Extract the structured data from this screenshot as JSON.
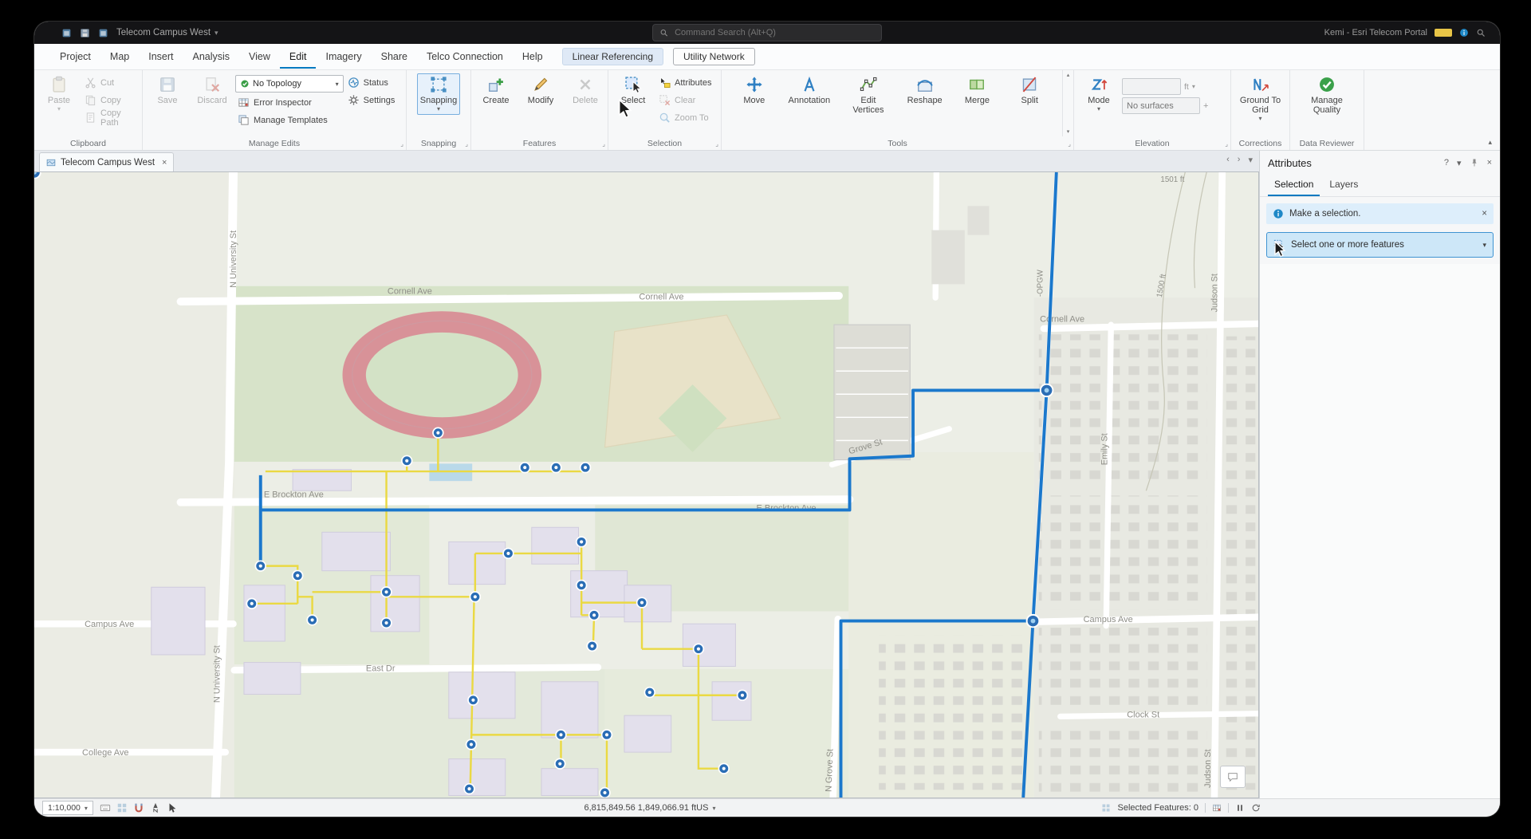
{
  "titlebar": {
    "title": "Telecom Campus West",
    "search_placeholder": "Command Search (Alt+Q)",
    "account": "Kemi - Esri Telecom Portal"
  },
  "menu": {
    "tabs": [
      "Project",
      "Map",
      "Insert",
      "Analysis",
      "View",
      "Edit",
      "Imagery",
      "Share",
      "Telco Connection",
      "Help"
    ],
    "contextual": [
      "Linear Referencing",
      "Utility Network"
    ]
  },
  "ribbon": {
    "clipboard": {
      "label": "Clipboard",
      "paste": "Paste",
      "cut": "Cut",
      "copy": "Copy",
      "copy_path": "Copy Path"
    },
    "manage_edits": {
      "label": "Manage Edits",
      "save": "Save",
      "discard": "Discard",
      "topology": "No Topology",
      "error_inspector": "Error Inspector",
      "manage_templates": "Manage Templates",
      "status": "Status",
      "settings": "Settings"
    },
    "snapping": {
      "label": "Snapping",
      "button": "Snapping"
    },
    "features": {
      "label": "Features",
      "create": "Create",
      "modify": "Modify",
      "delete": "Delete"
    },
    "selection": {
      "label": "Selection",
      "select": "Select",
      "attributes": "Attributes",
      "clear": "Clear",
      "zoom_to": "Zoom To"
    },
    "tools": {
      "label": "Tools",
      "move": "Move",
      "annotation": "Annotation",
      "edit_vertices": "Edit Vertices",
      "reshape": "Reshape",
      "merge": "Merge",
      "split": "Split"
    },
    "elevation": {
      "label": "Elevation",
      "mode": "Mode",
      "surfaces_placeholder": "No surfaces",
      "unit": "ft"
    },
    "corrections": {
      "label": "Corrections",
      "ground_to_grid": "Ground To Grid"
    },
    "data_reviewer": {
      "label": "Data Reviewer",
      "manage_quality": "Manage Quality"
    }
  },
  "map_tab": {
    "title": "Telecom Campus West"
  },
  "attributes_panel": {
    "title": "Attributes",
    "tab_selection": "Selection",
    "tab_layers": "Layers",
    "info_message": "Make a selection.",
    "dropdown_label": "Select one or more features"
  },
  "statusbar": {
    "scale": "1:10,000",
    "coordinates": "6,815,849.56 1,849,066.91 ftUS",
    "selected_features": "Selected Features: 0"
  },
  "map": {
    "labels": {
      "cornell_1": "Cornell Ave",
      "cornell_2": "Cornell Ave",
      "cornell_3": "Cornell Ave",
      "brockton_1": "E Brockton Ave",
      "brockton_2": "E Brockton Ave",
      "campus_left": "Campus Ave",
      "campus_right": "Campus Ave",
      "college": "College Ave",
      "east_dr": "East Dr",
      "grove": "Grove St",
      "clock": "Clock St",
      "n_university_1": "N University St",
      "n_university_2": "N University St",
      "emily": "Emily St",
      "judson_1": "Judson St",
      "judson_2": "Judson St",
      "n_grove": "N Grove St",
      "opgw": "-OPGW",
      "elev_top": "1501 ft",
      "elev_mid": "1500 ft"
    },
    "colors": {
      "utility_line": "#1b78cc",
      "fiber_line": "#ead943",
      "device": "#2a6db5"
    }
  },
  "glyphs": {
    "caret_down": "▾",
    "caret_up": "▴",
    "chevron_left": "‹",
    "chevron_right": "›",
    "close": "×",
    "help": "?",
    "plus": "+"
  }
}
